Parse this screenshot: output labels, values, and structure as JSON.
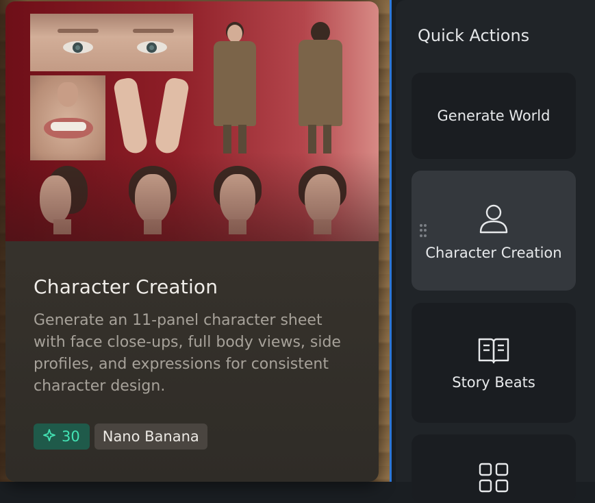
{
  "card": {
    "title": "Character Creation",
    "description": "Generate an 11-panel character sheet with face close-ups, full body views, side profiles, and expressions for consistent character design.",
    "credits": "30",
    "credits_icon": "sparkle-icon",
    "model": "Nano Banana"
  },
  "quick_actions": {
    "title": "Quick Actions",
    "items": [
      {
        "label": "Generate World",
        "icon": "none"
      },
      {
        "label": "Character Creation",
        "icon": "user-icon",
        "active": true
      },
      {
        "label": "Story Beats",
        "icon": "book-icon"
      },
      {
        "label": "",
        "icon": "grid-icon"
      }
    ]
  },
  "colors": {
    "accent": "#43e3b4",
    "selection_border": "#2d7be0"
  }
}
